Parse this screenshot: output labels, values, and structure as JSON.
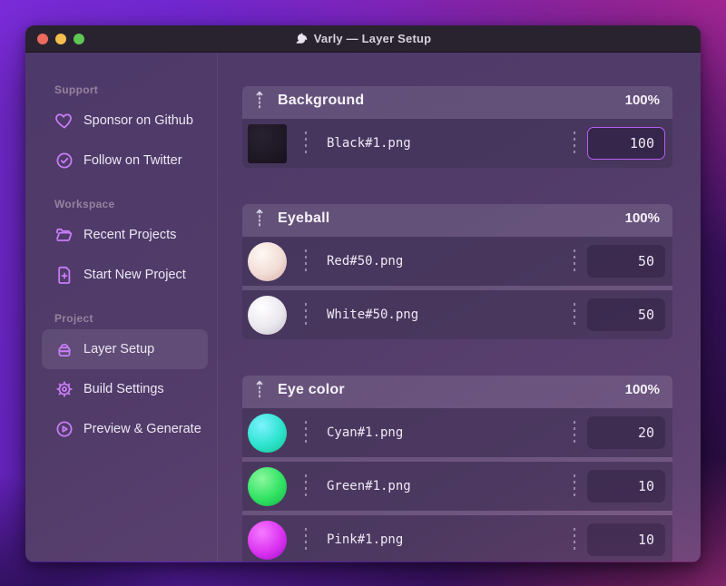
{
  "window": {
    "title": "Varly — Layer Setup"
  },
  "titlebar": {
    "traffic_lights": {
      "close": "#ec6a5e",
      "minimize": "#f5bf4f",
      "zoom": "#61c554"
    }
  },
  "colors": {
    "accent_icon": "#c77df5",
    "focused_input_border": "#b55ef0",
    "header_text": "#f6f3f9",
    "sidebar_label": "#96829e"
  },
  "sidebar": {
    "sections": [
      {
        "label": "Support",
        "items": [
          {
            "icon": "heart-icon",
            "label": "Sponsor on Github"
          },
          {
            "icon": "badge-check-icon",
            "label": "Follow on Twitter"
          }
        ]
      },
      {
        "label": "Workspace",
        "items": [
          {
            "icon": "folder-open-icon",
            "label": "Recent Projects"
          },
          {
            "icon": "file-plus-icon",
            "label": "Start New Project"
          }
        ]
      },
      {
        "label": "Project",
        "items": [
          {
            "icon": "layers-icon",
            "label": "Layer Setup",
            "selected": true
          },
          {
            "icon": "gear-icon",
            "label": "Build Settings"
          },
          {
            "icon": "play-circle-icon",
            "label": "Preview & Generate"
          }
        ]
      }
    ]
  },
  "main": {
    "groups": [
      {
        "title": "Background",
        "opacity": "100%",
        "rows": [
          {
            "filename": "Black#1.png",
            "value": "100",
            "focused": true,
            "thumb": {
              "shape": "square",
              "hi": "#282130",
              "mid": "#1f1926",
              "lo": "#17121d"
            }
          }
        ]
      },
      {
        "title": "Eyeball",
        "opacity": "100%",
        "rows": [
          {
            "filename": "Red#50.png",
            "value": "50",
            "thumb": {
              "shape": "circle",
              "hi": "#fff8f4",
              "mid": "#f2dcd6",
              "lo": "#d7b1a9"
            }
          },
          {
            "filename": "White#50.png",
            "value": "50",
            "thumb": {
              "shape": "circle",
              "hi": "#ffffff",
              "mid": "#ebe8ee",
              "lo": "#c7c1cd"
            }
          }
        ]
      },
      {
        "title": "Eye color",
        "opacity": "100%",
        "rows": [
          {
            "filename": "Cyan#1.png",
            "value": "20",
            "thumb": {
              "shape": "circle",
              "hi": "#7df2ff",
              "mid": "#2de3cf",
              "lo": "#17c78e"
            }
          },
          {
            "filename": "Green#1.png",
            "value": "10",
            "thumb": {
              "shape": "circle",
              "hi": "#8bf79e",
              "mid": "#30e363",
              "lo": "#16b648"
            }
          },
          {
            "filename": "Pink#1.png",
            "value": "10",
            "thumb": {
              "shape": "circle",
              "hi": "#f67bff",
              "mid": "#db33f1",
              "lo": "#a312cd"
            }
          }
        ]
      }
    ]
  }
}
